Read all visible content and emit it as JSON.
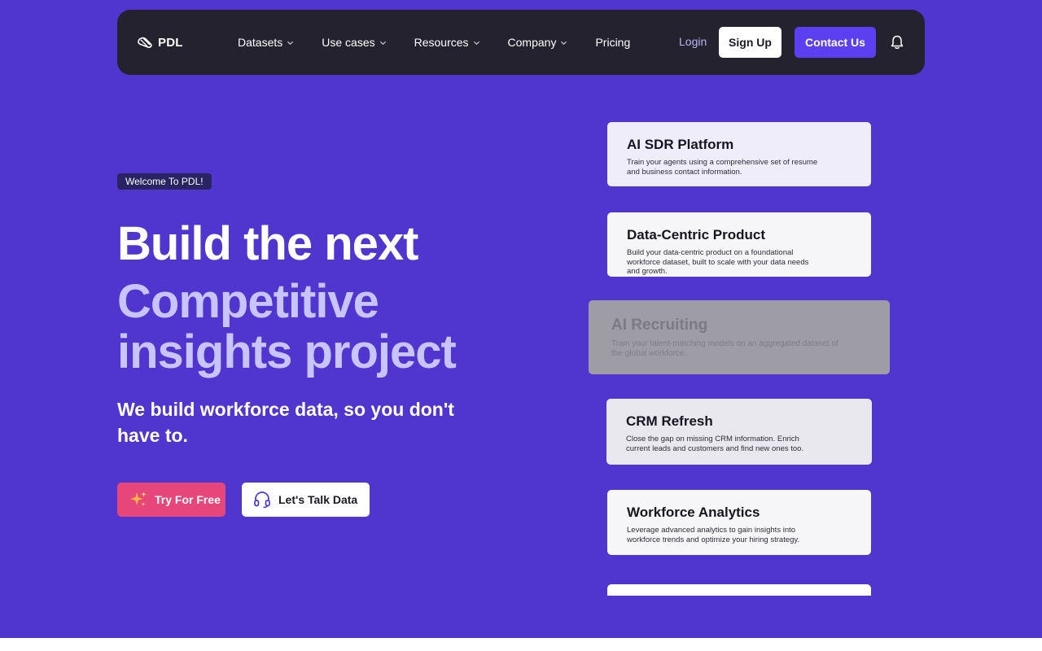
{
  "nav": {
    "logo_text": "PDL",
    "links": [
      {
        "label": "Datasets",
        "has_dropdown": true
      },
      {
        "label": "Use cases",
        "has_dropdown": true
      },
      {
        "label": "Resources",
        "has_dropdown": true
      },
      {
        "label": "Company",
        "has_dropdown": true
      },
      {
        "label": "Pricing",
        "has_dropdown": false
      }
    ],
    "login_label": "Login",
    "signup_label": "Sign Up",
    "contact_label": "Contact Us",
    "icons": {
      "logo": "pdl-logo-icon",
      "dropdown": "chevron-down-icon",
      "notifications": "bell-icon"
    }
  },
  "hero": {
    "badge": "Welcome To PDL!",
    "headline": "Build the next",
    "headline_accent": "Competitive insights project",
    "subheadline": "We build workforce data, so you don't have to.",
    "try_label": "Try For Free",
    "talk_label": "Let's Talk Data",
    "icons": {
      "try": "sparkle-icon",
      "talk": "headset-icon"
    }
  },
  "use_cases": [
    {
      "title": "AI SDR Platform",
      "description": "Train your agents using a comprehensive set of resume and business contact information."
    },
    {
      "title": "Data-Centric Product",
      "description": "Build your data-centric product on a foundational workforce dataset, built to scale with your data needs and growth."
    },
    {
      "title": "AI Recruiting",
      "description": "Train your talent-matching models on an aggregated dataset of the global workforce."
    },
    {
      "title": "CRM Refresh",
      "description": "Close the gap on missing CRM information. Enrich current leads and customers and find new ones too."
    },
    {
      "title": "Workforce Analytics",
      "description": "Leverage advanced analytics to gain insights into workforce trends and optimize your hiring strategy."
    }
  ],
  "colors": {
    "hero_bg": "#5035cf",
    "nav_bg": "#24222e",
    "accent_text": "#c7c4ff",
    "contact_button": "#5b3ff0",
    "try_button": "#e6467a"
  }
}
